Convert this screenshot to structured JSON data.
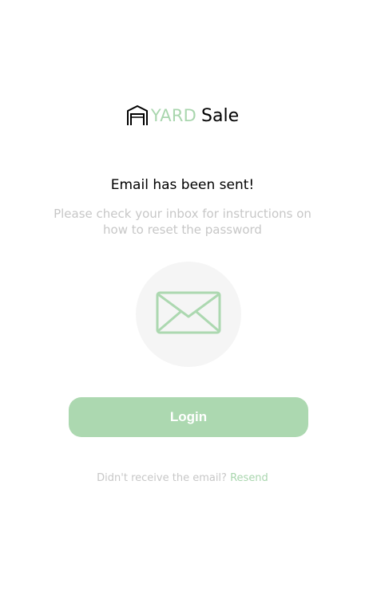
{
  "logo": {
    "icon": "garage-icon",
    "word_yard": "YARD",
    "word_sale": "Sale"
  },
  "message": {
    "title": "Email has been sent!",
    "subtitle": "Please check your inbox for instructions on how to reset the password"
  },
  "illustration": {
    "icon": "envelope-icon"
  },
  "actions": {
    "login_label": "Login"
  },
  "footer": {
    "prompt": "Didn't receive the email?",
    "resend_label": "Resend"
  },
  "colors": {
    "accent": "#acd8b0",
    "muted_text": "#c7c7c7",
    "circle_bg": "#f5f5f5"
  }
}
